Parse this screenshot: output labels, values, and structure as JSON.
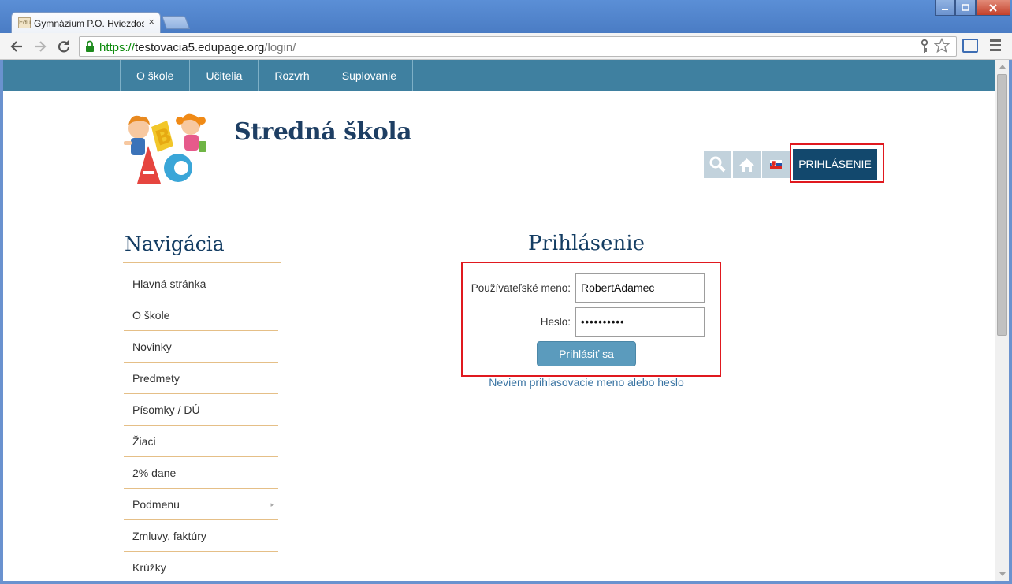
{
  "browser": {
    "tab_title": "Gymnázium P.O. Hviezdoslava",
    "tab_favicon_text": "Edu",
    "tab_close": "×",
    "url_scheme": "https://",
    "url_host": "testovacia5.edupage.org",
    "url_path": "/login/",
    "back_icon": "arrow-left-icon",
    "forward_icon": "arrow-right-icon",
    "reload_icon": "reload-icon",
    "key_icon": "key-icon",
    "star_icon": "star-icon"
  },
  "topnav": {
    "items": [
      "O škole",
      "Učitelia",
      "Rozvrh",
      "Suplovanie"
    ]
  },
  "header": {
    "site_title": "Stredná škola",
    "login_button": "PRIHLÁSENIE"
  },
  "sidebar": {
    "heading": "Navigácia",
    "items": [
      {
        "label": "Hlavná stránka"
      },
      {
        "label": "O škole"
      },
      {
        "label": "Novinky"
      },
      {
        "label": "Predmety"
      },
      {
        "label": "Písomky / DÚ"
      },
      {
        "label": "Žiaci"
      },
      {
        "label": "2% dane"
      },
      {
        "label": "Podmenu",
        "submenu_arrow": "▸"
      },
      {
        "label": "Zmluvy, faktúry"
      },
      {
        "label": "Krúžky"
      }
    ]
  },
  "login": {
    "title": "Prihlásenie",
    "username_label": "Používateľské meno:",
    "username_value": "RobertAdamec",
    "password_label": "Heslo:",
    "password_value": "••••••••••",
    "submit_label": "Prihlásiť sa",
    "forgot_link": "Neviem prihlasovacie meno alebo heslo"
  },
  "colors": {
    "topnav_bg": "#3f80a0",
    "login_btn_bg": "#12486d",
    "heading": "#143d63",
    "divider": "#e5bf87",
    "highlight": "#e0191f",
    "submit_bg": "#5b9bbd",
    "link": "#3a74a3"
  }
}
